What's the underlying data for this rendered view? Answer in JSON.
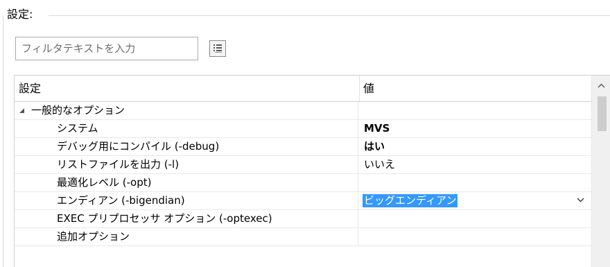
{
  "group": {
    "title": "設定:"
  },
  "filter": {
    "placeholder": "フィルタテキストを入力",
    "sort_icon": "sort-list-icon"
  },
  "grid": {
    "columns": [
      "設定",
      "値"
    ],
    "category": {
      "label": "一般的なオプション",
      "expanded": true,
      "expand_icon": "collapse-triangle-icon"
    },
    "rows": [
      {
        "name": "システム",
        "value": "MVS",
        "bold": true
      },
      {
        "name": "デバッグ用にコンパイル (-debug)",
        "value": "はい",
        "bold": true
      },
      {
        "name": "リストファイルを出力 (-l)",
        "value": "いいえ",
        "bold": false
      },
      {
        "name": "最適化レベル (-opt)",
        "value": "",
        "bold": false
      },
      {
        "name": "エンディアン (-bigendian)",
        "value": "ビッグエンディアン",
        "editing": true
      },
      {
        "name": "EXEC プリプロセッサ オプション (-optexec)",
        "value": "",
        "bold": false
      },
      {
        "name": "追加オプション",
        "value": "",
        "bold": false
      }
    ],
    "dropdown_icon": "chevron-down-icon"
  },
  "scrollbar": {
    "up_icon": "chevron-up-icon"
  },
  "colors": {
    "selection": "#3399ff",
    "border": "#cfcfcf"
  }
}
